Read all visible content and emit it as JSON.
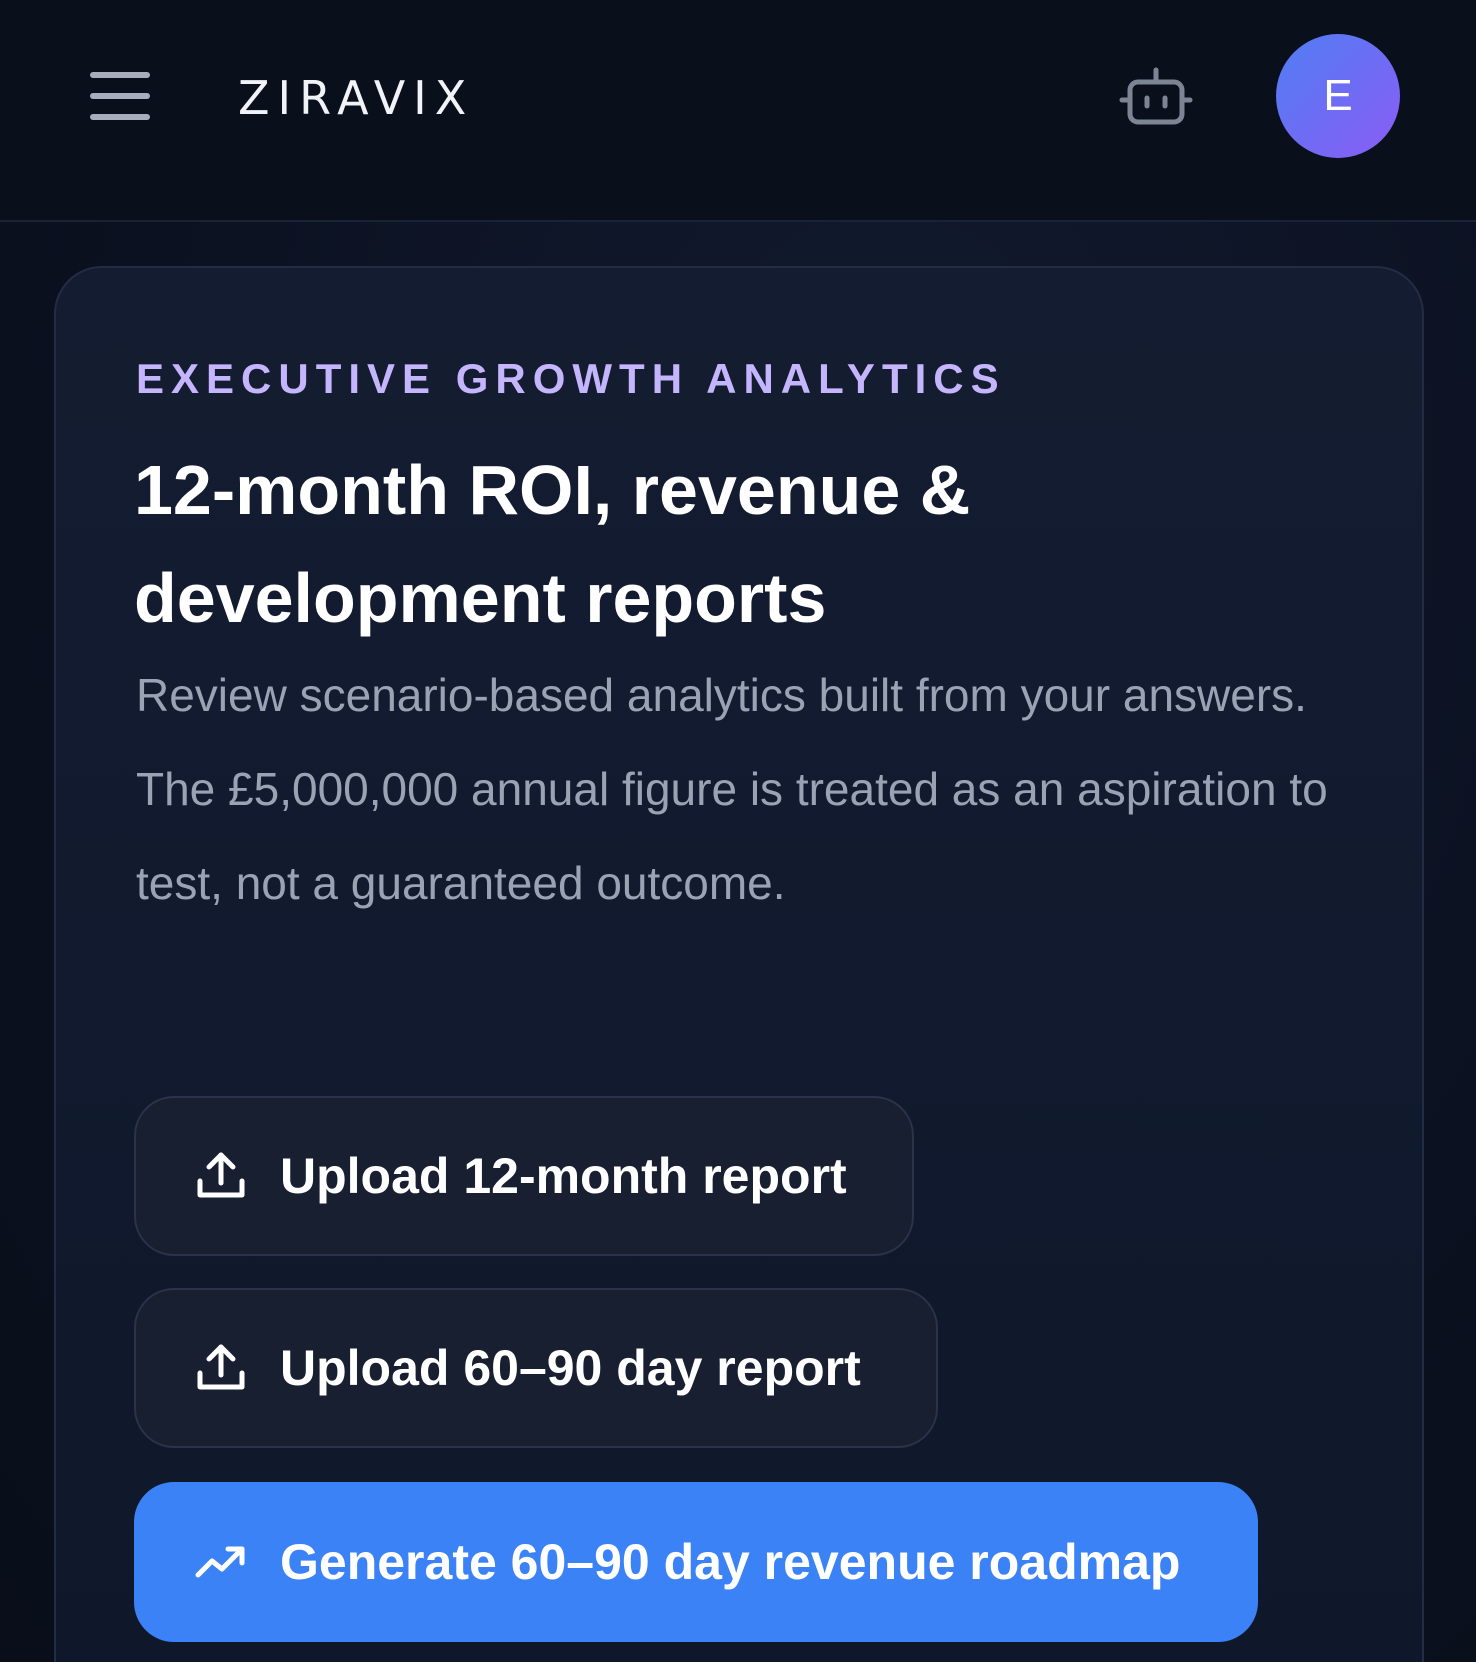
{
  "header": {
    "brand": "ZIRAVIX",
    "avatar_initial": "E",
    "icons": {
      "menu": "hamburger-menu-icon",
      "assistant": "robot-icon"
    }
  },
  "hero": {
    "eyebrow": "EXECUTIVE GROWTH ANALYTICS",
    "title_line1": "12-month ROI, revenue &",
    "title_line2": "development reports",
    "description": "Review scenario-based analytics built from your answers. The £5,000,000 annual figure is treated as an aspiration to test, not a guaranteed outcome."
  },
  "actions": {
    "upload_12_month": "Upload 12-month report",
    "upload_60_90_day": "Upload 60–90 day report",
    "generate_roadmap": "Generate 60–90 day revenue roadmap"
  },
  "colors": {
    "background": "#0b1120",
    "accent_purple": "#c4b5fd",
    "primary_button": "#3b82f6",
    "avatar_gradient_start": "#4f7ef2",
    "avatar_gradient_end": "#8b5cf6"
  }
}
